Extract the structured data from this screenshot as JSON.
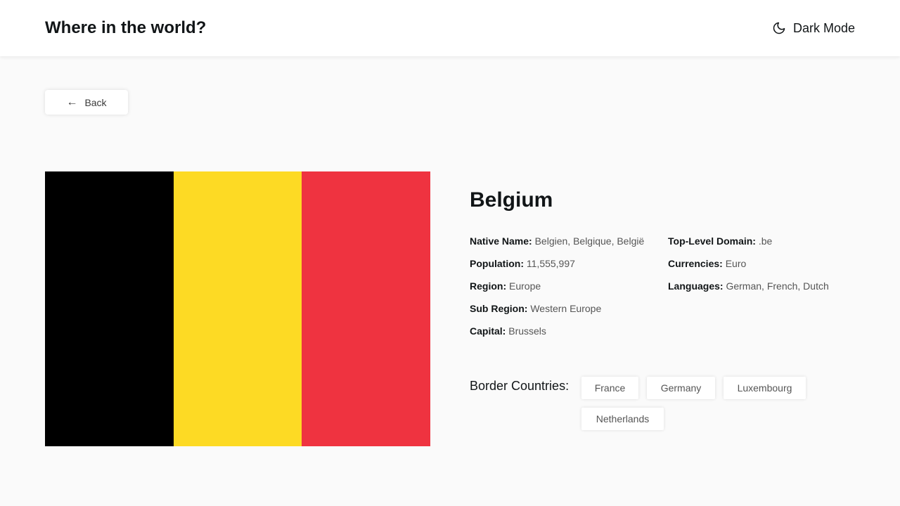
{
  "header": {
    "title": "Where in the world?",
    "dark_mode_label": "Dark Mode",
    "dark_mode_icon": "moon-icon"
  },
  "back_button": {
    "label": "Back",
    "arrow": "←",
    "icon": "arrow-left-icon"
  },
  "flag": {
    "colors": [
      "#000000",
      "#FDDA24",
      "#EF3340"
    ]
  },
  "country": {
    "name": "Belgium",
    "details_left": [
      {
        "label": "Native Name:",
        "value": "Belgien, Belgique, België"
      },
      {
        "label": "Population:",
        "value": "11,555,997"
      },
      {
        "label": "Region:",
        "value": "Europe"
      },
      {
        "label": "Sub Region:",
        "value": "Western Europe"
      },
      {
        "label": "Capital:",
        "value": "Brussels"
      }
    ],
    "details_right": [
      {
        "label": "Top-Level Domain:",
        "value": ".be"
      },
      {
        "label": "Currencies:",
        "value": "Euro"
      },
      {
        "label": "Languages:",
        "value": "German, French, Dutch"
      }
    ],
    "border_label": "Border Countries:",
    "borders": [
      "France",
      "Germany",
      "Luxembourg",
      "Netherlands"
    ]
  }
}
